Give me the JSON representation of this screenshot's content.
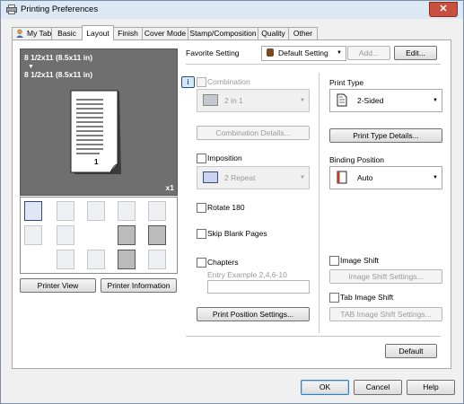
{
  "window": {
    "title": "Printing Preferences",
    "close_glyph": "✕"
  },
  "tabs": [
    {
      "label": "My Tab"
    },
    {
      "label": "Basic"
    },
    {
      "label": "Layout"
    },
    {
      "label": "Finish"
    },
    {
      "label": "Cover Mode"
    },
    {
      "label": "Stamp/Composition"
    },
    {
      "label": "Quality"
    },
    {
      "label": "Other"
    }
  ],
  "active_tab": "Layout",
  "preview": {
    "original_size": "8 1/2x11 (8.5x11 in)",
    "arrow": "▼",
    "output_size": "8 1/2x11 (8.5x11 in)",
    "page_number": "1",
    "copies": "x1"
  },
  "left_buttons": {
    "printer_view": "Printer View",
    "printer_information": "Printer Information"
  },
  "favorite": {
    "label": "Favorite Setting",
    "value": "Default Setting",
    "add": "Add...",
    "edit": "Edit..."
  },
  "combination": {
    "label": "Combination",
    "value": "2 in 1",
    "details": "Combination Details..."
  },
  "imposition": {
    "label": "Imposition",
    "value": "2 Repeat"
  },
  "rotate180": {
    "label": "Rotate 180"
  },
  "skip_blank": {
    "label": "Skip Blank Pages"
  },
  "chapters": {
    "label": "Chapters",
    "example": "Entry Example 2,4,6-10",
    "value": ""
  },
  "print_position": {
    "button": "Print Position Settings..."
  },
  "print_type": {
    "label": "Print Type",
    "value": "2-Sided",
    "details": "Print Type Details..."
  },
  "binding_position": {
    "label": "Binding Position",
    "value": "Auto"
  },
  "image_shift": {
    "label": "Image Shift",
    "settings": "Image Shift Settings..."
  },
  "tab_image_shift": {
    "label": "Tab Image Shift",
    "settings": "TAB Image Shift Settings..."
  },
  "default_button": "Default",
  "dialog_buttons": {
    "ok": "OK",
    "cancel": "Cancel",
    "help": "Help"
  },
  "colors": {
    "preview_bg": "#6f6f6f",
    "accent": "#3c7fb1",
    "disabled_text": "#9a9a9a",
    "close": "#c7503f"
  }
}
